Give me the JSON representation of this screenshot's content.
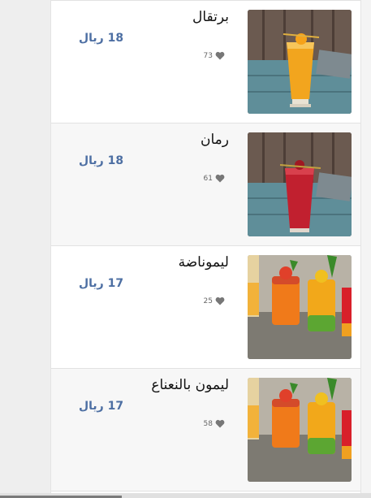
{
  "menu": {
    "items": [
      {
        "name": "برتقال",
        "price": "18 ريال",
        "likes": "73",
        "photo": "orange-juice-glass"
      },
      {
        "name": "رمان",
        "price": "18 ريال",
        "likes": "61",
        "photo": "pomegranate-juice-glass"
      },
      {
        "name": "ليموناضة",
        "price": "17 ريال",
        "likes": "25",
        "photo": "assorted-juices"
      },
      {
        "name": "ليمون بالنعناع",
        "price": "17 ريال",
        "likes": "58",
        "photo": "assorted-juices"
      }
    ]
  },
  "colors": {
    "price": "#4d6fa3",
    "heart": "#777777",
    "name": "#111111"
  }
}
